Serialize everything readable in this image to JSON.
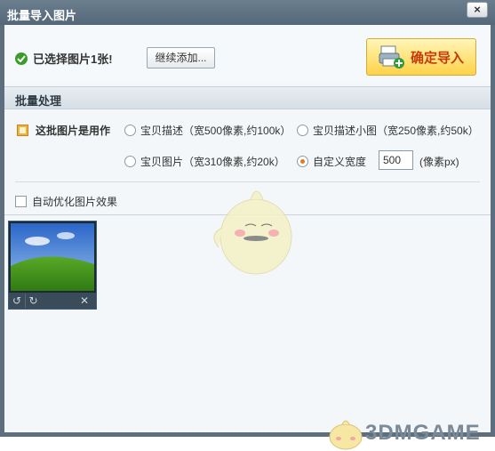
{
  "window": {
    "title": "批量导入图片",
    "close_glyph": "×"
  },
  "top": {
    "selected_text": "已选择图片1张!",
    "add_more_label": "继续添加...",
    "confirm_label": "确定导入"
  },
  "batch": {
    "header": "批量处理",
    "usage_label": "这批图片是用作",
    "options": [
      {
        "label": "宝贝描述（宽500像素,约100k）",
        "checked": false
      },
      {
        "label": "宝贝描述小图（宽250像素,约50k）",
        "checked": false
      },
      {
        "label": "宝贝图片（宽310像素,约20k）",
        "checked": false
      },
      {
        "label": "自定义宽度",
        "checked": true
      }
    ],
    "custom_width_value": "500",
    "custom_width_unit": "(像素px)"
  },
  "auto_optimize": {
    "label": "自动优化图片效果",
    "checked": false
  },
  "thumbnails": [
    {
      "name": "green-hills-image",
      "icons": [
        "rotate-left-icon",
        "rotate-right-icon",
        "delete-icon"
      ]
    }
  ],
  "watermark": {
    "text": "3DMGAME"
  },
  "colors": {
    "accent_orange": "#c43a0d",
    "confirm_bg": "#ffd248",
    "titlebar": "#5d6f7e"
  }
}
